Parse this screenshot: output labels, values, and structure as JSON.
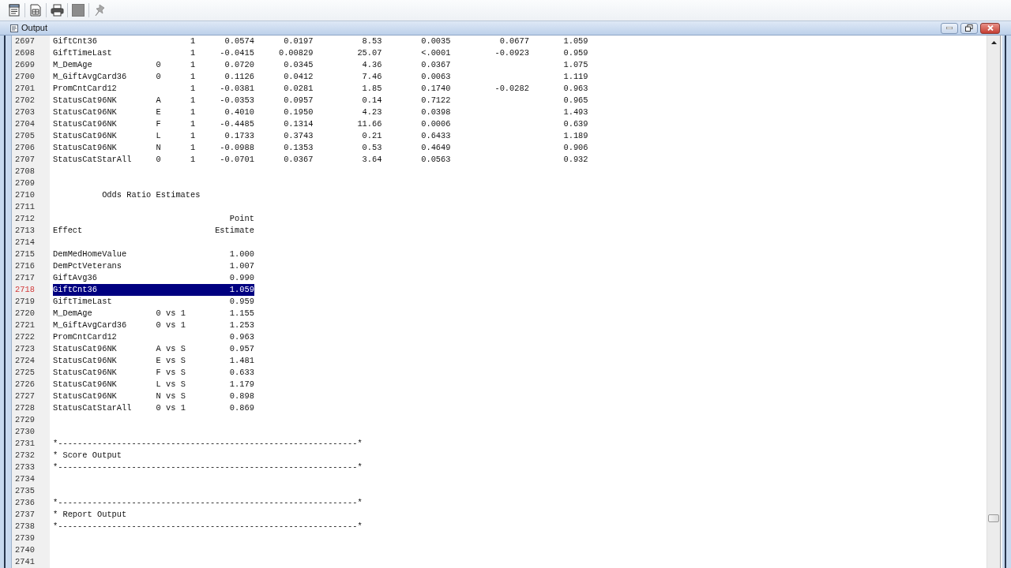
{
  "toolbar": [
    {
      "kind": "document",
      "disabled": false
    },
    {
      "kind": "page",
      "disabled": false
    },
    {
      "kind": "printer",
      "disabled": false
    },
    {
      "kind": "square",
      "disabled": true
    },
    {
      "kind": "pin",
      "disabled": true
    }
  ],
  "window": {
    "title": "Output"
  },
  "editor": {
    "lines": [
      {
        "number": "2697",
        "kind": "estimate_row",
        "selected": false,
        "column_1": "GiftCnt36",
        "column_3": "1",
        "column_4": "0.0574",
        "column_5": "0.0197",
        "column_6": "8.53",
        "column_7": "0.0035",
        "column_8": "0.0677",
        "column_9": "1.059"
      },
      {
        "number": "2698",
        "kind": "estimate_row",
        "selected": false,
        "column_1": "GiftTimeLast",
        "column_3": "1",
        "column_4": "-0.0415",
        "column_5": "0.00829",
        "column_6": "25.07",
        "column_7": "<.0001",
        "column_8": "-0.0923",
        "column_9": "0.959"
      },
      {
        "number": "2699",
        "kind": "estimate_row",
        "selected": false,
        "column_1": "M_DemAge",
        "column_2": "0",
        "column_3": "1",
        "column_4": "0.0720",
        "column_5": "0.0345",
        "column_6": "4.36",
        "column_7": "0.0367",
        "column_9": "1.075"
      },
      {
        "number": "2700",
        "kind": "estimate_row",
        "selected": false,
        "column_1": "M_GiftAvgCard36",
        "column_2": "0",
        "column_3": "1",
        "column_4": "0.1126",
        "column_5": "0.0412",
        "column_6": "7.46",
        "column_7": "0.0063",
        "column_9": "1.119"
      },
      {
        "number": "2701",
        "kind": "estimate_row",
        "selected": false,
        "column_1": "PromCntCard12",
        "column_3": "1",
        "column_4": "-0.0381",
        "column_5": "0.0281",
        "column_6": "1.85",
        "column_7": "0.1740",
        "column_8": "-0.0282",
        "column_9": "0.963"
      },
      {
        "number": "2702",
        "kind": "estimate_row",
        "selected": false,
        "column_1": "StatusCat96NK",
        "column_2": "A",
        "column_3": "1",
        "column_4": "-0.0353",
        "column_5": "0.0957",
        "column_6": "0.14",
        "column_7": "0.7122",
        "column_9": "0.965"
      },
      {
        "number": "2703",
        "kind": "estimate_row",
        "selected": false,
        "column_1": "StatusCat96NK",
        "column_2": "E",
        "column_3": "1",
        "column_4": "0.4010",
        "column_5": "0.1950",
        "column_6": "4.23",
        "column_7": "0.0398",
        "column_9": "1.493"
      },
      {
        "number": "2704",
        "kind": "estimate_row",
        "selected": false,
        "column_1": "StatusCat96NK",
        "column_2": "F",
        "column_3": "1",
        "column_4": "-0.4485",
        "column_5": "0.1314",
        "column_6": "11.66",
        "column_7": "0.0006",
        "column_9": "0.639"
      },
      {
        "number": "2705",
        "kind": "estimate_row",
        "selected": false,
        "column_1": "StatusCat96NK",
        "column_2": "L",
        "column_3": "1",
        "column_4": "0.1733",
        "column_5": "0.3743",
        "column_6": "0.21",
        "column_7": "0.6433",
        "column_9": "1.189"
      },
      {
        "number": "2706",
        "kind": "estimate_row",
        "selected": false,
        "column_1": "StatusCat96NK",
        "column_2": "N",
        "column_3": "1",
        "column_4": "-0.0988",
        "column_5": "0.1353",
        "column_6": "0.53",
        "column_7": "0.4649",
        "column_9": "0.906"
      },
      {
        "number": "2707",
        "kind": "estimate_row",
        "selected": false,
        "column_1": "StatusCatStarAll",
        "column_2": "0",
        "column_3": "1",
        "column_4": "-0.0701",
        "column_5": "0.0367",
        "column_6": "3.64",
        "column_7": "0.0563",
        "column_9": "0.932"
      },
      {
        "number": "2708",
        "kind": "blank",
        "selected": false
      },
      {
        "number": "2709",
        "kind": "blank",
        "selected": false
      },
      {
        "number": "2710",
        "kind": "title",
        "selected": false,
        "text": "Odds Ratio Estimates"
      },
      {
        "number": "2711",
        "kind": "blank",
        "selected": false
      },
      {
        "number": "2712",
        "kind": "header",
        "selected": false,
        "column_3": "Point"
      },
      {
        "number": "2713",
        "kind": "header",
        "selected": false,
        "column_1": "Effect",
        "column_3": "Estimate"
      },
      {
        "number": "2714",
        "kind": "blank",
        "selected": false
      },
      {
        "number": "2715",
        "kind": "odds_row",
        "selected": false,
        "column_1": "DemMedHomeValue",
        "column_3": "1.000"
      },
      {
        "number": "2716",
        "kind": "odds_row",
        "selected": false,
        "column_1": "DemPctVeterans",
        "column_3": "1.007"
      },
      {
        "number": "2717",
        "kind": "odds_row",
        "selected": false,
        "column_1": "GiftAvg36",
        "column_3": "0.990"
      },
      {
        "number": "2718",
        "kind": "odds_row",
        "selected": true,
        "column_1": "GiftCnt36",
        "column_3": "1.059"
      },
      {
        "number": "2719",
        "kind": "odds_row",
        "selected": false,
        "column_1": "GiftTimeLast",
        "column_3": "0.959"
      },
      {
        "number": "2720",
        "kind": "odds_row",
        "selected": false,
        "column_1": "M_DemAge",
        "column_2": "0 vs 1",
        "column_3": "1.155"
      },
      {
        "number": "2721",
        "kind": "odds_row",
        "selected": false,
        "column_1": "M_GiftAvgCard36",
        "column_2": "0 vs 1",
        "column_3": "1.253"
      },
      {
        "number": "2722",
        "kind": "odds_row",
        "selected": false,
        "column_1": "PromCntCard12",
        "column_3": "0.963"
      },
      {
        "number": "2723",
        "kind": "odds_row",
        "selected": false,
        "column_1": "StatusCat96NK",
        "column_2": "A vs S",
        "column_3": "0.957"
      },
      {
        "number": "2724",
        "kind": "odds_row",
        "selected": false,
        "column_1": "StatusCat96NK",
        "column_2": "E vs S",
        "column_3": "1.481"
      },
      {
        "number": "2725",
        "kind": "odds_row",
        "selected": false,
        "column_1": "StatusCat96NK",
        "column_2": "F vs S",
        "column_3": "0.633"
      },
      {
        "number": "2726",
        "kind": "odds_row",
        "selected": false,
        "column_1": "StatusCat96NK",
        "column_2": "L vs S",
        "column_3": "1.179"
      },
      {
        "number": "2727",
        "kind": "odds_row",
        "selected": false,
        "column_1": "StatusCat96NK",
        "column_2": "N vs S",
        "column_3": "0.898"
      },
      {
        "number": "2728",
        "kind": "odds_row",
        "selected": false,
        "column_1": "StatusCatStarAll",
        "column_2": "0 vs 1",
        "column_3": "0.869"
      },
      {
        "number": "2729",
        "kind": "blank",
        "selected": false
      },
      {
        "number": "2730",
        "kind": "blank",
        "selected": false
      },
      {
        "number": "2731",
        "kind": "text",
        "selected": false,
        "text": "*-------------------------------------------------------------*"
      },
      {
        "number": "2732",
        "kind": "text",
        "selected": false,
        "text": "* Score Output"
      },
      {
        "number": "2733",
        "kind": "text",
        "selected": false,
        "text": "*-------------------------------------------------------------*"
      },
      {
        "number": "2734",
        "kind": "blank",
        "selected": false
      },
      {
        "number": "2735",
        "kind": "blank",
        "selected": false
      },
      {
        "number": "2736",
        "kind": "text",
        "selected": false,
        "text": "*-------------------------------------------------------------*"
      },
      {
        "number": "2737",
        "kind": "text",
        "selected": false,
        "text": "* Report Output"
      },
      {
        "number": "2738",
        "kind": "text",
        "selected": false,
        "text": "*-------------------------------------------------------------*"
      },
      {
        "number": "2739",
        "kind": "blank",
        "selected": false
      },
      {
        "number": "2740",
        "kind": "blank",
        "selected": false
      },
      {
        "number": "2741",
        "kind": "blank",
        "selected": false
      }
    ]
  }
}
